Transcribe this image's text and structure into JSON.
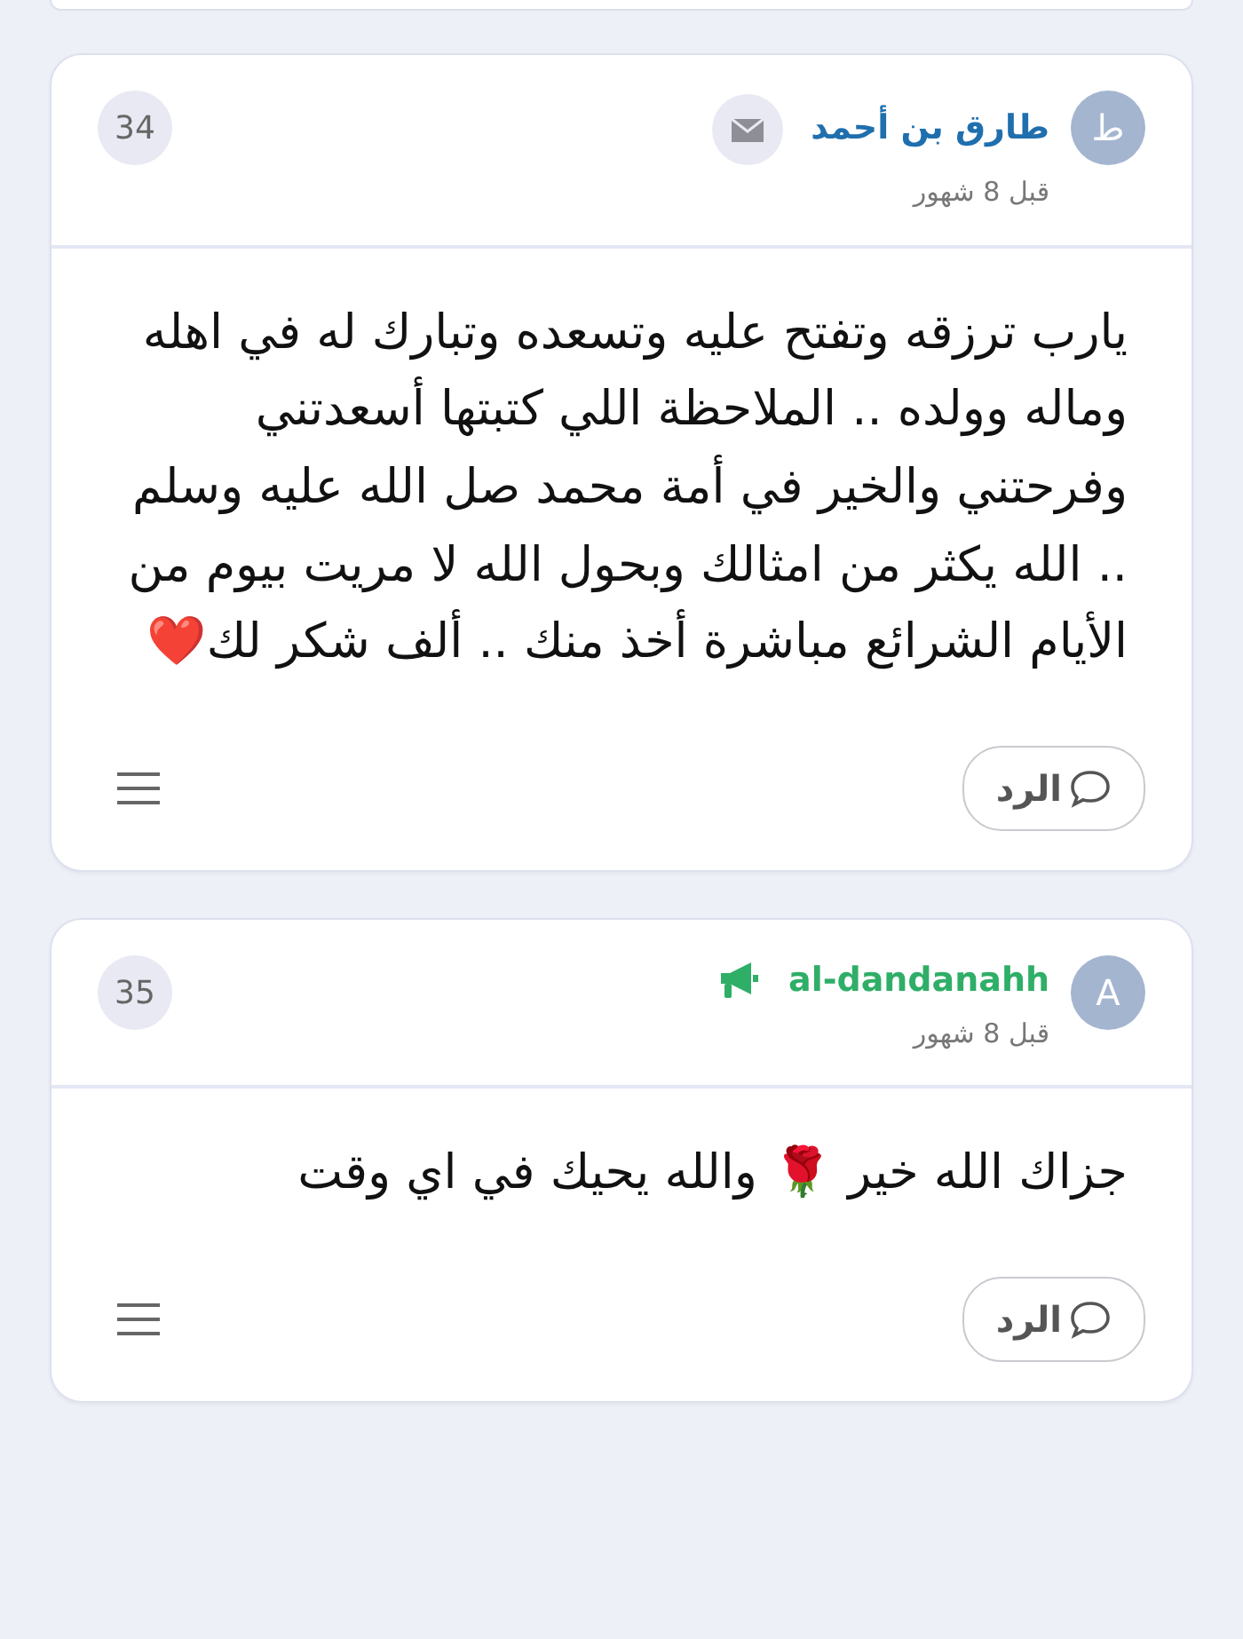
{
  "posts": [
    {
      "number": "34",
      "avatar": "ط",
      "author": "طارق بن أحمد",
      "kind": "member",
      "time": "قبل 8 شهور",
      "text": "يارب ترزقه وتفتح عليه وتسعده وتبارك له في اهله وماله وولده .. الملاحظة اللي كتبتها أسعدتني وفرحتني والخير في أمة محمد صل الله عليه وسلم .. الله يكثر من امثالك وبحول الله لا مريت بيوم من الأيام الشرائع مباشرة أخذ منك .. ألف شكر لك❤️",
      "reply": "الرد"
    },
    {
      "number": "35",
      "avatar": "A",
      "author": "al-dandanahh",
      "kind": "announcer",
      "time": "قبل 8 شهور",
      "text": "جزاك الله خير 🌹 والله يحيك في اي وقت",
      "reply": "الرد"
    }
  ]
}
